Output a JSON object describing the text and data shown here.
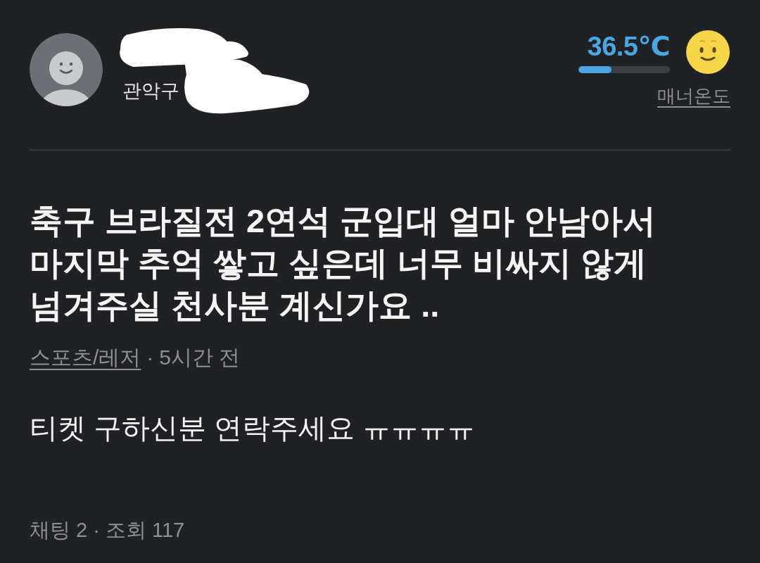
{
  "profile": {
    "location": "관악구",
    "name_redacted": true
  },
  "manner_temperature": {
    "value": "36.5℃",
    "level": 0.365,
    "label": "매너온도"
  },
  "post": {
    "title": "축구 브라질전 2연석 군입대 얼마 안남아서 마지막 추억 쌓고 싶은데 너무 비싸지 않게 넘겨주실 천사분 계신가요 ..",
    "category": "스포츠/레저",
    "separator": "·",
    "time": "5시간 전",
    "body": "티켓 구하신분 연락주세요 ㅠㅠㅠㅠ",
    "stats": "채팅 2 · 조회 117"
  }
}
